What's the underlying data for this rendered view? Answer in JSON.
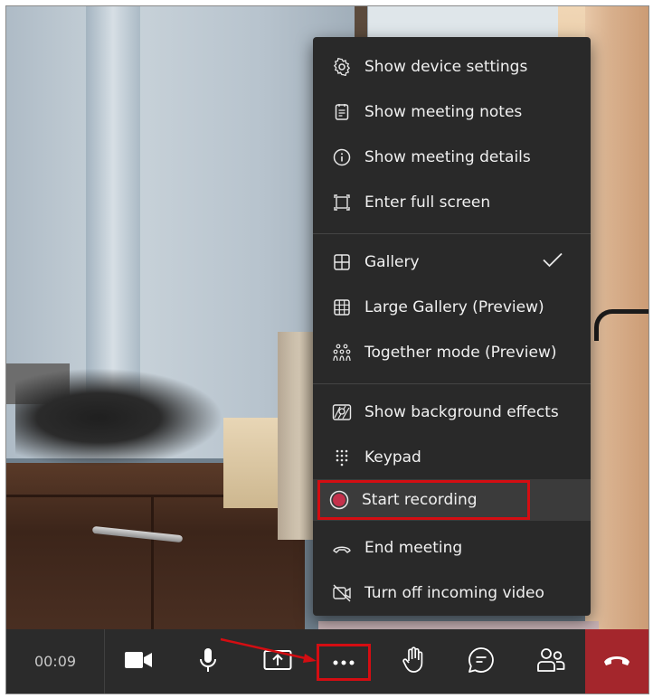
{
  "menu": {
    "items": [
      {
        "label": "Show device settings",
        "icon": "gear-icon"
      },
      {
        "label": "Show meeting notes",
        "icon": "notes-icon"
      },
      {
        "label": "Show meeting details",
        "icon": "info-icon"
      },
      {
        "label": "Enter full screen",
        "icon": "fullscreen-icon"
      },
      {
        "label": "Gallery",
        "icon": "gallery-icon",
        "checked": true
      },
      {
        "label": "Large Gallery (Preview)",
        "icon": "large-gallery-icon"
      },
      {
        "label": "Together mode (Preview)",
        "icon": "together-mode-icon"
      },
      {
        "label": "Show background effects",
        "icon": "background-effects-icon"
      },
      {
        "label": "Keypad",
        "icon": "keypad-icon"
      },
      {
        "label": "Start recording",
        "icon": "record-icon",
        "highlighted": true
      },
      {
        "label": "End meeting",
        "icon": "end-meeting-icon"
      },
      {
        "label": "Turn off incoming video",
        "icon": "video-off-icon"
      }
    ]
  },
  "toolbar": {
    "timer": "00:09",
    "buttons": [
      "camera-icon",
      "microphone-icon",
      "share-screen-icon",
      "more-options-icon",
      "raise-hand-icon",
      "chat-icon",
      "participants-icon"
    ],
    "hangup_icon": "hang-up-icon"
  },
  "colors": {
    "menu_bg": "#292929",
    "toolbar_bg": "#2b2b2b",
    "hangup_bg": "#a4262c",
    "annotation_red": "#d40d12",
    "record_dot": "#c4314b"
  }
}
